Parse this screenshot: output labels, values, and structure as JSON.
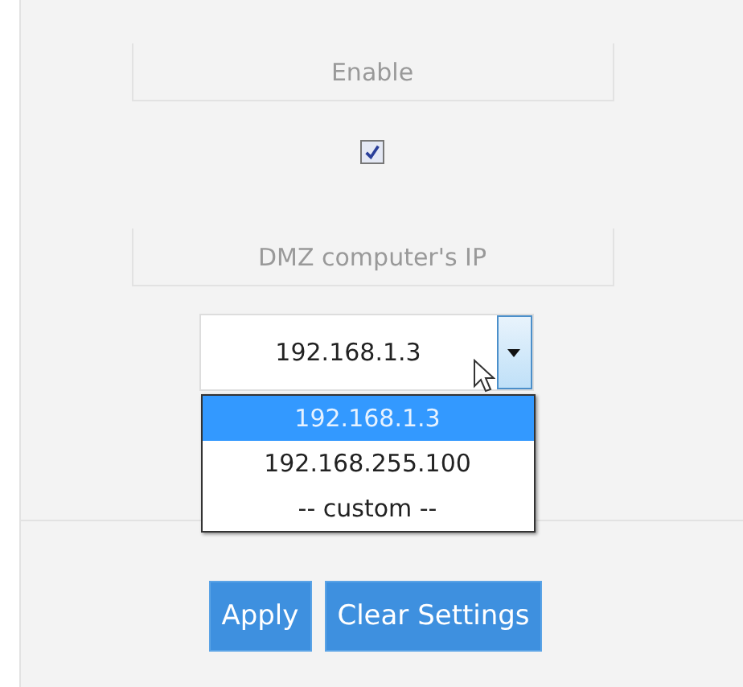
{
  "enable": {
    "label": "Enable",
    "checked": true
  },
  "dmz": {
    "label": "DMZ computer's IP",
    "value": "192.168.1.3",
    "expanded": true,
    "options": [
      {
        "label": "192.168.1.3",
        "selected": true
      },
      {
        "label": "192.168.255.100",
        "selected": false
      },
      {
        "label": "-- custom --",
        "selected": false
      }
    ]
  },
  "buttons": [
    "Apply",
    "Clear Settings"
  ]
}
